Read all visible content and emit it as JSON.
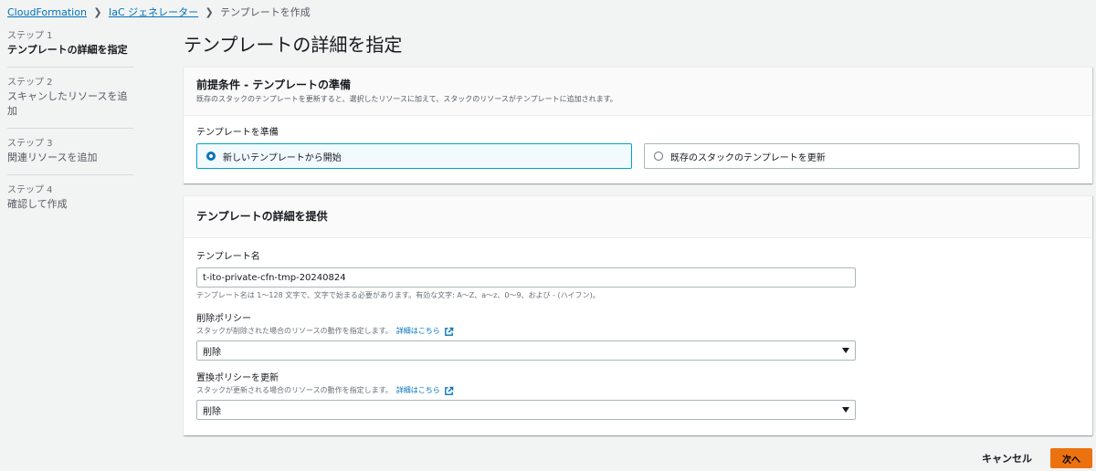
{
  "breadcrumb": {
    "items": [
      "CloudFormation",
      "IaC ジェネレーター"
    ],
    "current": "テンプレートを作成"
  },
  "steps": [
    {
      "num": "ステップ 1",
      "name": "テンプレートの詳細を指定"
    },
    {
      "num": "ステップ 2",
      "name": "スキャンしたリソースを追加"
    },
    {
      "num": "ステップ 3",
      "name": "関連リソースを追加"
    },
    {
      "num": "ステップ 4",
      "name": "確認して作成"
    }
  ],
  "page_title": "テンプレートの詳細を指定",
  "prereq": {
    "title": "前提条件 - テンプレートの準備",
    "description": "既存のスタックのテンプレートを更新すると、選択したリソースに加えて、スタックのリソースがテンプレートに追加されます。",
    "label": "テンプレートを準備",
    "options": [
      "新しいテンプレートから開始",
      "既存のスタックのテンプレートを更新"
    ],
    "selected": "新しいテンプレートから開始"
  },
  "details": {
    "title": "テンプレートの詳細を提供",
    "name_label": "テンプレート名",
    "name_value": "t-ito-private-cfn-tmp-20240824",
    "name_constraint": "テンプレート名は 1～128 文字で、文字で始まる必要があります。有効な文字: A～Z、a～z、0～9、および - (ハイフン)。",
    "deletion_label": "削除ポリシー",
    "deletion_desc": "スタックが削除された場合のリソースの動作を指定します。",
    "deletion_value": "削除",
    "replace_label": "置換ポリシーを更新",
    "replace_desc": "スタックが更新される場合のリソースの動作を指定します。",
    "replace_value": "削除",
    "info_link": "詳細はこちら"
  },
  "footer": {
    "cancel": "キャンセル",
    "next": "次へ"
  },
  "colors": {
    "accent": "#ec7211",
    "link": "#0073bb",
    "selected_border": "#00a1c9"
  }
}
